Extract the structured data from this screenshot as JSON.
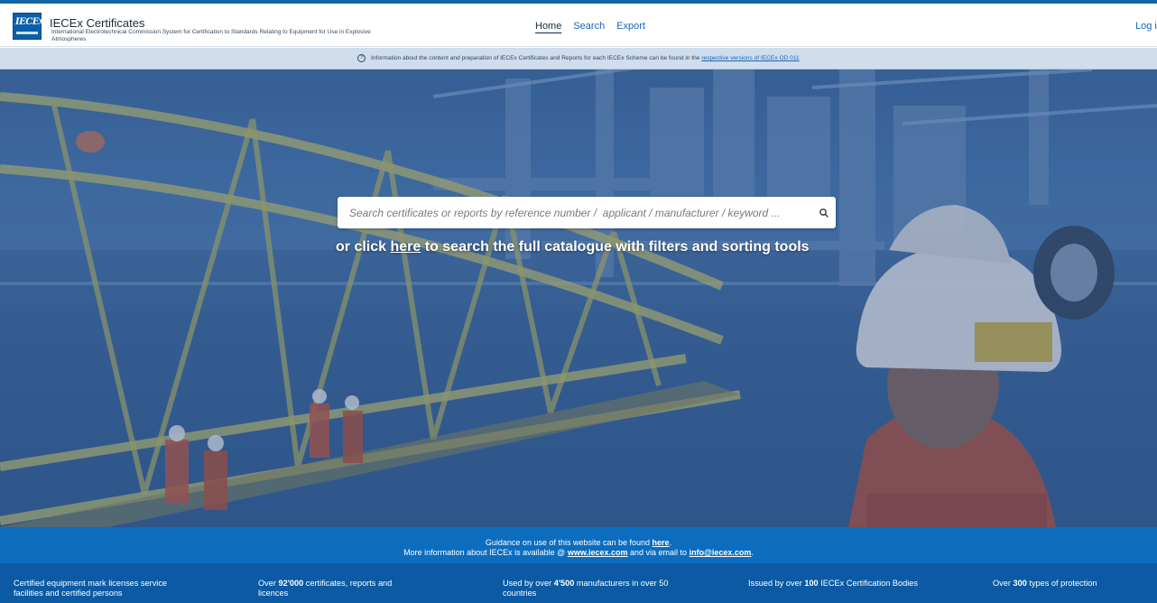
{
  "header": {
    "logo_text": "IECEx",
    "title": "IECEx Certificates",
    "subtitle": "International Electrotechnical Commission System for Certification to Standards Relating to Equipment for Use in Explosive Atmospheres",
    "nav": [
      {
        "label": "Home",
        "active": true
      },
      {
        "label": "Search",
        "active": false
      },
      {
        "label": "Export",
        "active": false
      }
    ],
    "login_label": "Log i"
  },
  "info_bar": {
    "icon": "question-circle-icon",
    "text": "Information about the content and preparation of IECEx Certificates and Reports for each IECEx Scheme can be found in the",
    "link_text": "respective versions of IECEx OD 011"
  },
  "hero": {
    "search_placeholder": "Search certificates or reports by reference number /  applicant / manufacturer / keyword ...",
    "search_icon": "search-icon",
    "cta_prefix": "or click",
    "cta_link": "here",
    "cta_suffix": "to search the full catalogue with filters and sorting tools"
  },
  "guidance": {
    "line1_prefix": "Guidance on use of this website can be found",
    "line1_link": "here",
    "line1_suffix": ".",
    "line2_prefix": "More information about IECEx is available @",
    "line2_link": "www.iecex.com",
    "line2_middle": "and via email to",
    "line2_email": "info@iecex.com",
    "line2_suffix": "."
  },
  "stats": [
    {
      "prefix": "Certified equipment mark licenses service facilities and certified persons",
      "bold": "",
      "suffix": ""
    },
    {
      "prefix": "Over",
      "bold": "92'000",
      "suffix": "certificates, reports and licences"
    },
    {
      "prefix": "Used by over",
      "bold": "4'500",
      "suffix": "manufacturers in over 50 countries"
    },
    {
      "prefix": "Issued by over",
      "bold": "100",
      "suffix": "IECEx Certification Bodies"
    },
    {
      "prefix": "Over",
      "bold": "300",
      "suffix": "types of protection"
    }
  ],
  "colors": {
    "accent": "#1565a8",
    "info_bar": "#cfdded",
    "guidance_band": "#0c6dbf",
    "stats_band": "#0b5aa3"
  }
}
